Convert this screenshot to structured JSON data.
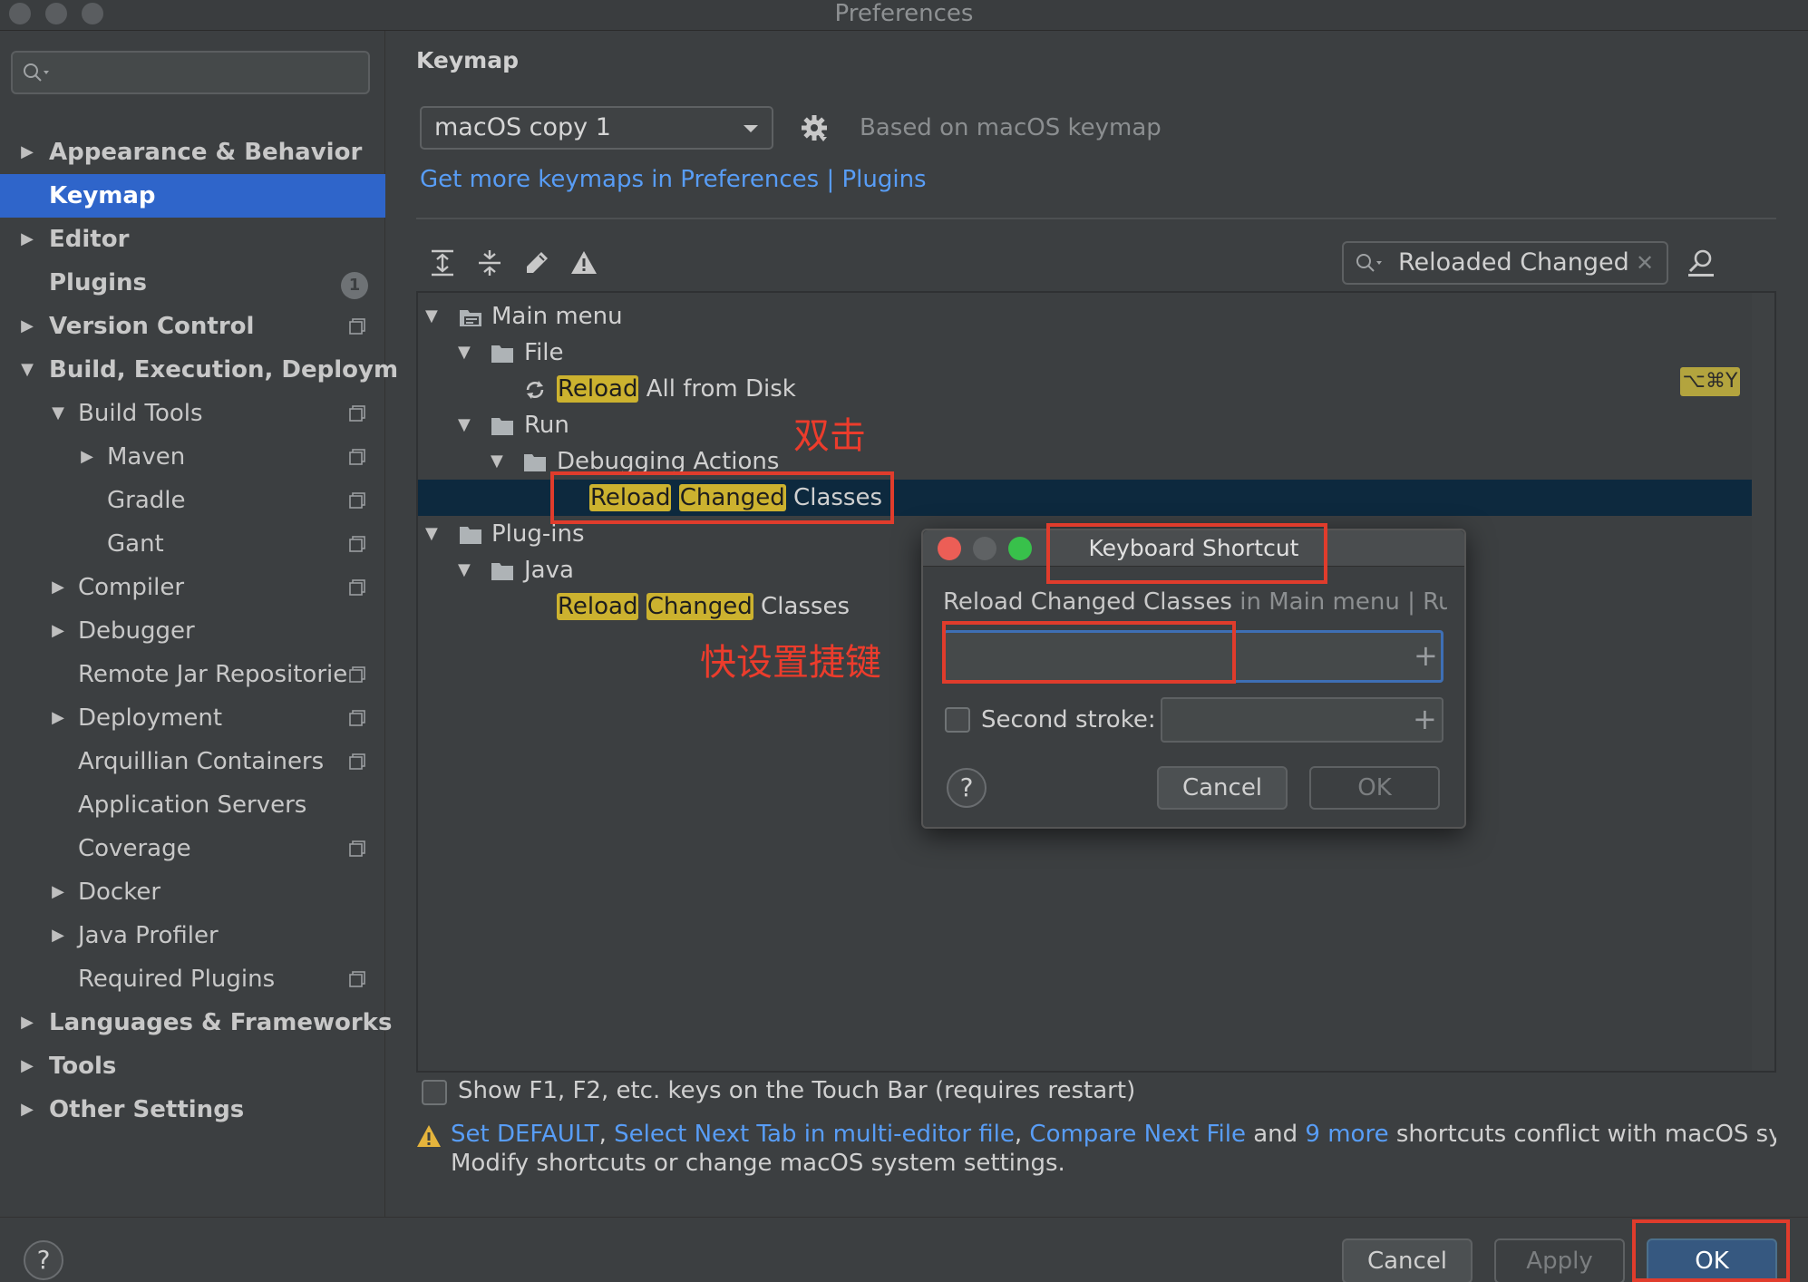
{
  "window": {
    "title": "Preferences"
  },
  "sidebar": {
    "search_placeholder": "",
    "items": [
      {
        "label": "Appearance & Behavior"
      },
      {
        "label": "Keymap"
      },
      {
        "label": "Editor"
      },
      {
        "label": "Plugins",
        "badge": "1"
      },
      {
        "label": "Version Control"
      },
      {
        "label": "Build, Execution, Deploym"
      },
      {
        "label": "Build Tools"
      },
      {
        "label": "Maven"
      },
      {
        "label": "Gradle"
      },
      {
        "label": "Gant"
      },
      {
        "label": "Compiler"
      },
      {
        "label": "Debugger"
      },
      {
        "label": "Remote Jar Repositorie"
      },
      {
        "label": "Deployment"
      },
      {
        "label": "Arquillian Containers"
      },
      {
        "label": "Application Servers"
      },
      {
        "label": "Coverage"
      },
      {
        "label": "Docker"
      },
      {
        "label": "Java Profiler"
      },
      {
        "label": "Required Plugins"
      },
      {
        "label": "Languages & Frameworks"
      },
      {
        "label": "Tools"
      },
      {
        "label": "Other Settings"
      }
    ]
  },
  "main": {
    "title": "Keymap",
    "keymap_select_value": "macOS copy 1",
    "based_on": "Based on macOS keymap",
    "get_more_link": "Get more keymaps in Preferences | Plugins",
    "filter_value": "Reloaded Changed"
  },
  "tree": {
    "main_menu": "Main menu",
    "file": "File",
    "reload_all_hl": "Reload",
    "reload_all_rest": " All from Disk",
    "reload_all_shortcut": "⌥⌘Y",
    "run": "Run",
    "debugging_actions": "Debugging Actions",
    "rcc1_hl1": "Reload",
    "rcc1_hl2": "Changed",
    "rcc1_rest": " Classes",
    "plugins": "Plug-ins",
    "java": "Java",
    "rcc2_hl1": "Reload",
    "rcc2_hl2": "Changed",
    "rcc2_rest": " Classes"
  },
  "annotations": {
    "double_click": "双击",
    "set_shortcut": "快设置捷键"
  },
  "dialog": {
    "title": "Keyboard Shortcut",
    "action": "Reload Changed Classes",
    "context": " in Main menu | Run |",
    "second_stroke_label": "Second stroke:",
    "cancel": "Cancel",
    "ok": "OK",
    "help": "?"
  },
  "bottom": {
    "touchbar_label": "Show F1, F2, etc. keys on the Touch Bar (requires restart)",
    "conflict_link1": "Set DEFAULT",
    "conflict_sep1": ", ",
    "conflict_link2": "Select Next Tab in multi-editor file",
    "conflict_sep2": ", ",
    "conflict_link3": "Compare Next File",
    "conflict_and": " and ",
    "conflict_link4": "9 more",
    "conflict_tail": " shortcuts conflict with macOS syst",
    "conflict_line2": "Modify shortcuts or change macOS system settings."
  },
  "footer": {
    "help": "?",
    "cancel": "Cancel",
    "apply": "Apply",
    "ok": "OK"
  },
  "colors": {
    "accent": "#2f65ca",
    "link": "#589df6",
    "highlight": "#ccb22f",
    "annotation": "#e03c2c"
  }
}
